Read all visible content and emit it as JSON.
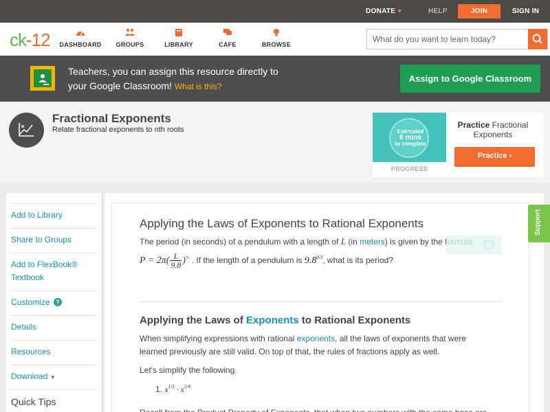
{
  "topbar": {
    "donate": "DONATE",
    "help": "HELP",
    "join": "JOIN",
    "sign_in": "SIGN IN"
  },
  "nav": {
    "logo_a": "ck",
    "logo_b": "-12",
    "items": [
      {
        "label": "DASHBOARD",
        "icon": "dashboard-icon"
      },
      {
        "label": "GROUPS",
        "icon": "groups-icon"
      },
      {
        "label": "LIBRARY",
        "icon": "library-icon"
      },
      {
        "label": "CAFE",
        "icon": "cafe-icon"
      },
      {
        "label": "BROWSE",
        "icon": "browse-icon"
      }
    ],
    "search_placeholder": "What do you want to learn today?"
  },
  "banner": {
    "line1": "Teachers, you can assign this resource directly to",
    "line2": "your Google Classroom!",
    "what": "What is this?",
    "assign": "Assign to Google Classroom"
  },
  "concept": {
    "title": "Fractional Exponents",
    "subtitle": "Relate fractional exponents to nth roots",
    "estimated": "Estimated",
    "mins": "6 mins",
    "to_complete": "to complete",
    "progress": "PROGRESS",
    "practice_bold": "Practice",
    "practice_rest": "Fractional Exponents",
    "practice_button": "Practice"
  },
  "sidebar": {
    "items": [
      "Add to Library",
      "Share to Groups",
      "Add to FlexBook®",
      "Textbook",
      "Customize",
      "Details",
      "Resources",
      "Download",
      "Quick Tips"
    ]
  },
  "article": {
    "title": "Applying the Laws of Exponents to Rational Exponents",
    "p1_a": "The period (in seconds) of a pendulum with a length of ",
    "p1_L": "L",
    "p1_b": " (in ",
    "p1_link": "meters",
    "p1_c": ") is given by the formula",
    "p2_a": ". If the length of a pendulum is",
    "p2_b": ", what is its period?",
    "h2_a": "Applying the Laws of ",
    "h2_link": "Exponents",
    "h2_b": " to Rational Exponents",
    "p3_a": "When simplifying expressions with rational ",
    "p3_link": "exponents",
    "p3_b": ", all the laws of exponents that were",
    "p4": "learned previously are still valid. On top of that, the rules of fractions apply as well.",
    "p5": "Let's simplify the following.",
    "item1": "1.",
    "p6": "Recall from the Product Property of Exponents, that when two numbers with the same base are"
  },
  "support": "Support",
  "colors": {
    "accent": "#f26b2f",
    "brand_green": "#62b74d",
    "link": "#1a8fb0",
    "classroom_green": "#1e9e55"
  }
}
